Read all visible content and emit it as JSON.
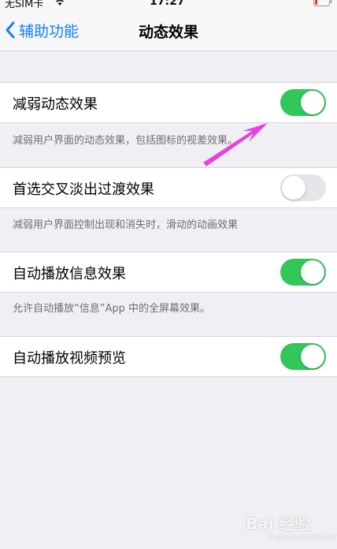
{
  "status_bar": {
    "carrier": "无SIM卡",
    "time": "17:27",
    "wifi_icon": "wifi-icon",
    "battery_icon": "battery-icon"
  },
  "nav": {
    "back_label": "辅助功能",
    "back_icon": "chevron-left-icon",
    "title": "动态效果"
  },
  "settings": [
    {
      "label": "减弱动态效果",
      "on": true,
      "footer": "减弱用户界面的动态效果，包括图标的视差效果。"
    },
    {
      "label": "首选交叉淡出过渡效果",
      "on": false,
      "footer": "减弱用户界面控制出现和消失时，滑动的动画效果"
    },
    {
      "label": "自动播放信息效果",
      "on": true,
      "footer": "允许自动播放“信息”App 中的全屏幕效果。"
    },
    {
      "label": "自动播放视频预览",
      "on": true
    }
  ],
  "colors": {
    "toggle_on": "#33c75a",
    "toggle_off": "#e6e6ea",
    "accent": "#157efb",
    "annotation_arrow": "#e83ce0"
  },
  "watermark": {
    "brand": "Bai 经验",
    "sub": "jingyan.baidu.com"
  }
}
